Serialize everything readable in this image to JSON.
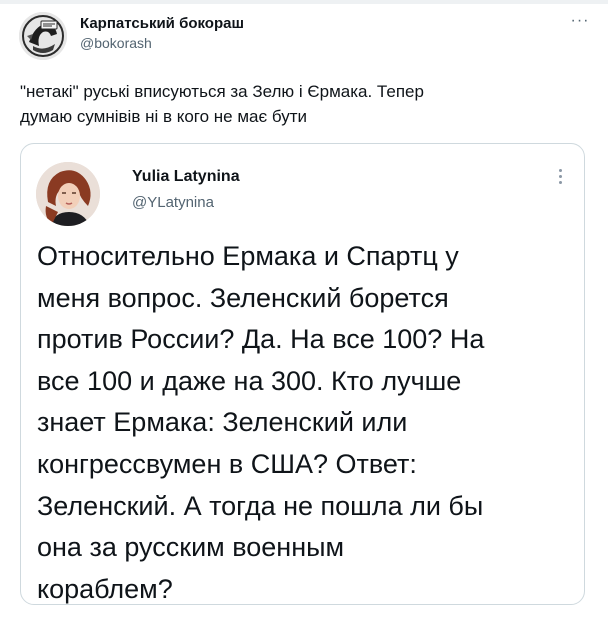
{
  "tweet": {
    "author_name": "Карпатський бокораш",
    "author_handle": "@bokorash",
    "more_icon": "ellipsis-icon",
    "text": "\"нетакі\" руські вписуються за Зелю і Єрмака. Тепер\nдумаю сумнівів ні в кого не має бути"
  },
  "quote": {
    "author_name": "Yulia Latynina",
    "author_handle": "@YLatynina",
    "more_icon": "vertical-ellipsis-icon",
    "text": "Относительно Ермака и Спартц у\nменя вопрос. Зеленский борется\nпротив России? Да. На все 100? На\nвсе 100 и даже на 300. Кто лучше\nзнает Ермака: Зеленский или\nконгрессвумен в США? Ответ:\nЗеленский. А тогда не пошла ли бы\nона за русским военным\nкораблем?"
  },
  "colors": {
    "text": "#0f1419",
    "secondary_text": "#536471",
    "card_border": "#cfd9de"
  }
}
